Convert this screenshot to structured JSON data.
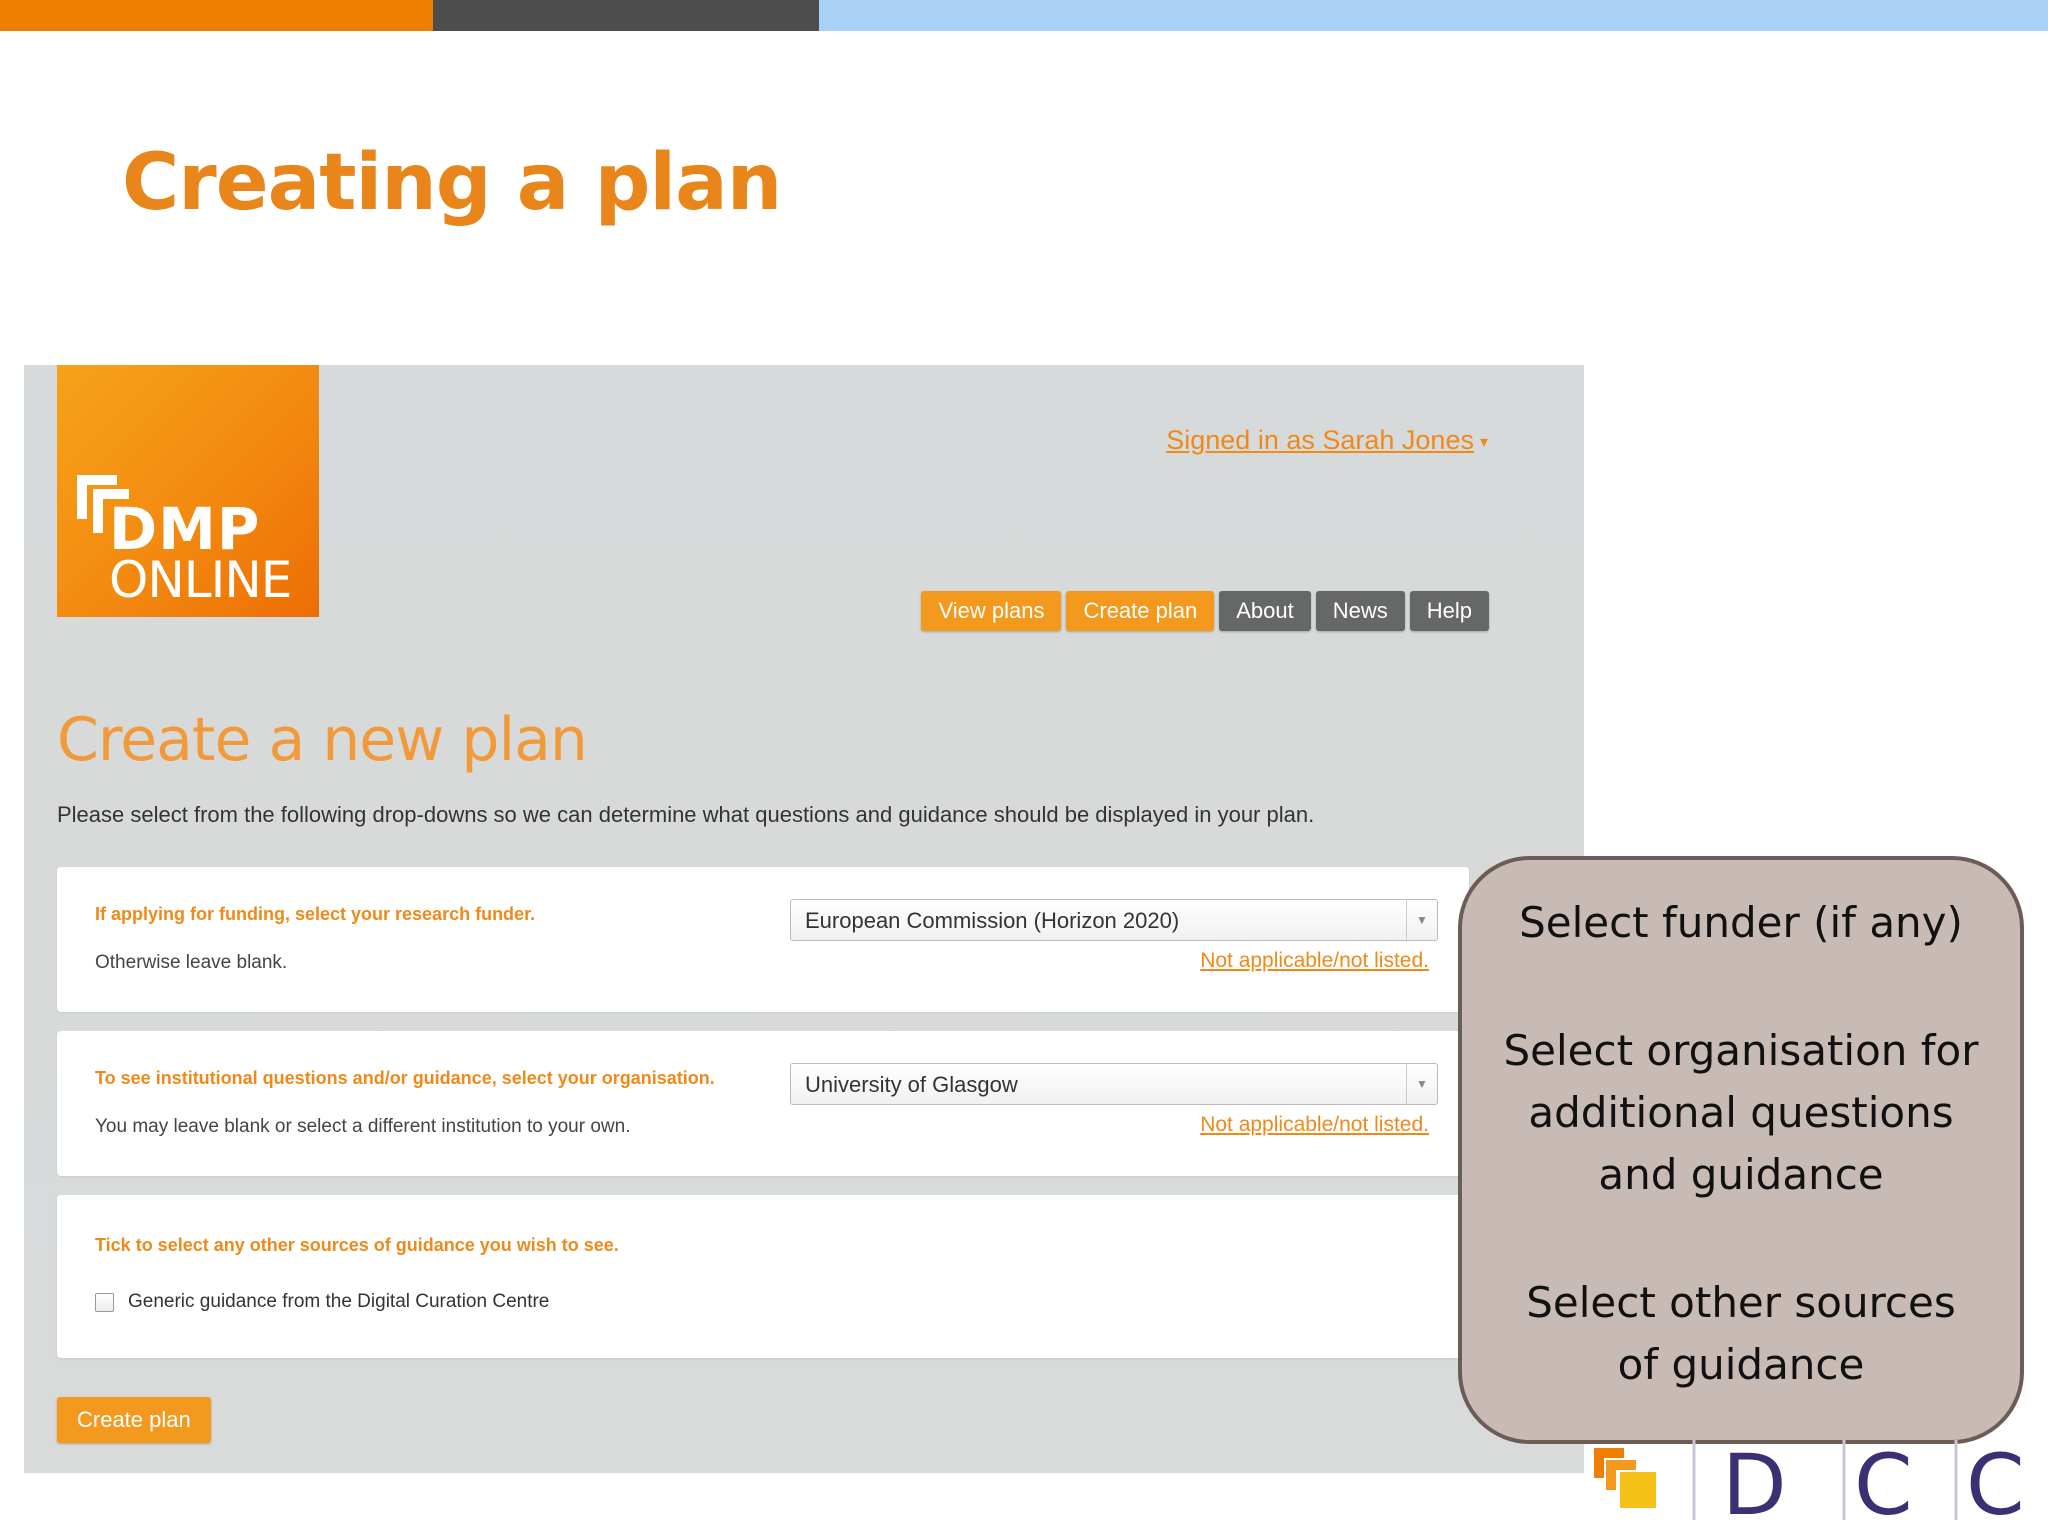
{
  "slide": {
    "title": "Creating a plan",
    "colors": {
      "accent": "#ee7f00",
      "dark": "#4d4d4d",
      "light_blue": "#a9d0f5"
    }
  },
  "app": {
    "logo": {
      "line1": "DMP",
      "line2": "ONLINE"
    },
    "user": {
      "signed_in": "Signed in as Sarah Jones"
    },
    "nav": [
      {
        "label": "View plans",
        "style": "orange"
      },
      {
        "label": "Create plan",
        "style": "orange"
      },
      {
        "label": "About",
        "style": "dark"
      },
      {
        "label": "News",
        "style": "dark"
      },
      {
        "label": "Help",
        "style": "dark"
      }
    ],
    "page": {
      "heading": "Create a new plan",
      "intro": "Please select from the following drop-downs so we can determine what questions and guidance should be displayed in your plan."
    },
    "funder": {
      "label": "If applying for funding, select your research funder.",
      "sub": "Otherwise leave blank.",
      "selected": "European Commission (Horizon 2020)",
      "na_link": "Not applicable/not listed."
    },
    "organisation": {
      "label": "To see institutional questions and/or guidance, select your organisation.",
      "sub": "You may leave blank or select a different institution to your own.",
      "selected": "University of Glasgow",
      "na_link": "Not applicable/not listed."
    },
    "guidance": {
      "label": "Tick to select any other sources of guidance you wish to see.",
      "option": "Generic guidance from the Digital Curation Centre",
      "checked": false
    },
    "create_button": "Create plan"
  },
  "callout": {
    "lines": [
      "Select funder (if any)",
      "Select organisation for",
      "additional questions",
      "and guidance",
      "Select other sources",
      "of guidance"
    ]
  },
  "footer_logo": {
    "text": "DCC",
    "color": "#3a3175"
  }
}
